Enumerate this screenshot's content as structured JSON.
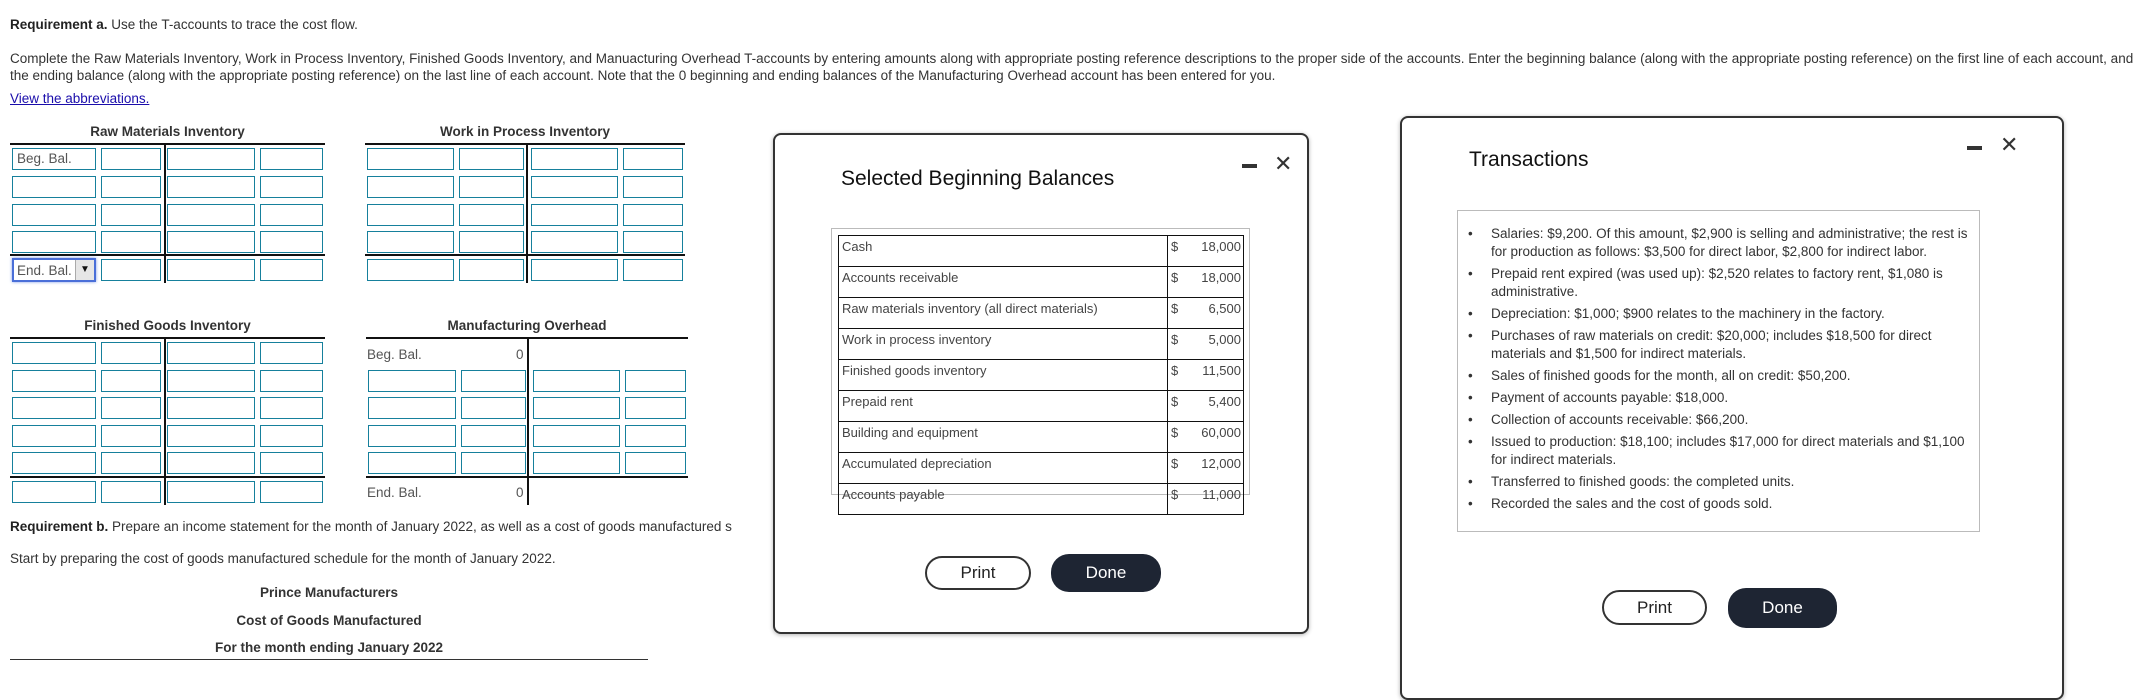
{
  "requirement_a": {
    "label": "Requirement a.",
    "text": " Use the T-accounts to trace the cost flow.",
    "instructions": "Complete the Raw Materials Inventory, Work in Process Inventory, Finished Goods Inventory, and Manuacturing Overhead T-accounts by entering amounts along with appropriate posting reference descriptions to the proper side of the accounts. Enter the beginning balance (along with the appropriate posting reference) on the first line of each account, and the ending balance (along with the appropriate posting reference) on the last line of each account. Note that the 0 beginning and ending balances of the Manufacturing Overhead account has been entered for you.",
    "abbrev_link": "View the abbreviations."
  },
  "t_accounts": {
    "raw_materials": {
      "title": "Raw Materials Inventory",
      "beg_label": "Beg. Bal.",
      "end_select": "End. Bal."
    },
    "wip": {
      "title": "Work in Process Inventory"
    },
    "finished_goods": {
      "title": "Finished Goods Inventory"
    },
    "overhead": {
      "title": "Manufacturing Overhead",
      "beg_label": "Beg. Bal.",
      "beg_value": "0",
      "end_label": "End. Bal.",
      "end_value": "0"
    }
  },
  "requirement_b": {
    "label": "Requirement b.",
    "text": " Prepare an income statement for the month of January 2022, as well as a cost of goods manufactured s",
    "start": "Start by preparing the cost of goods manufactured schedule for the month of January 2022.",
    "company": "Prince Manufacturers",
    "schedule": "Cost of Goods Manufactured",
    "period": "For the month ending January 2022"
  },
  "balances_modal": {
    "title": "Selected Beginning Balances",
    "rows": [
      {
        "account": "Cash",
        "currency": "$",
        "amount": "18,000"
      },
      {
        "account": "Accounts receivable",
        "currency": "$",
        "amount": "18,000"
      },
      {
        "account": "Raw materials inventory (all direct materials)",
        "currency": "$",
        "amount": "6,500"
      },
      {
        "account": "Work in process inventory",
        "currency": "$",
        "amount": "5,000"
      },
      {
        "account": "Finished goods inventory",
        "currency": "$",
        "amount": "11,500"
      },
      {
        "account": "Prepaid rent",
        "currency": "$",
        "amount": "5,400"
      },
      {
        "account": "Building and equipment",
        "currency": "$",
        "amount": "60,000"
      },
      {
        "account": "Accumulated depreciation",
        "currency": "$",
        "amount": "12,000"
      },
      {
        "account": "Accounts payable",
        "currency": "$",
        "amount": "11,000"
      }
    ],
    "print_label": "Print",
    "done_label": "Done",
    "close_glyph": "✕"
  },
  "transactions_modal": {
    "title": "Transactions",
    "items": [
      "Salaries: $9,200. Of this amount, $2,900 is selling and administrative; the rest is for production as follows: $3,500 for direct labor, $2,800 for indirect labor.",
      "Prepaid rent expired (was used up): $2,520 relates to factory rent, $1,080 is administrative.",
      "Depreciation: $1,000; $900 relates to the machinery in the factory.",
      "Purchases of raw materials on credit: $20,000; includes $18,500 for direct materials and $1,500 for indirect materials.",
      "Sales of finished goods for the month, all on credit: $50,200.",
      "Payment of accounts payable: $18,000.",
      "Collection of accounts receivable: $66,200.",
      "Issued to production: $18,100; includes $17,000 for direct materials and $1,100 for indirect materials.",
      "Transferred to finished goods: the completed units.",
      "Recorded the sales and the cost of goods sold."
    ],
    "print_label": "Print",
    "done_label": "Done",
    "close_glyph": "✕"
  },
  "colors": {
    "input_border": "#16809c",
    "done_button": "#1e2533",
    "link": "#1a0dab",
    "focus": "#4a6fd8"
  }
}
